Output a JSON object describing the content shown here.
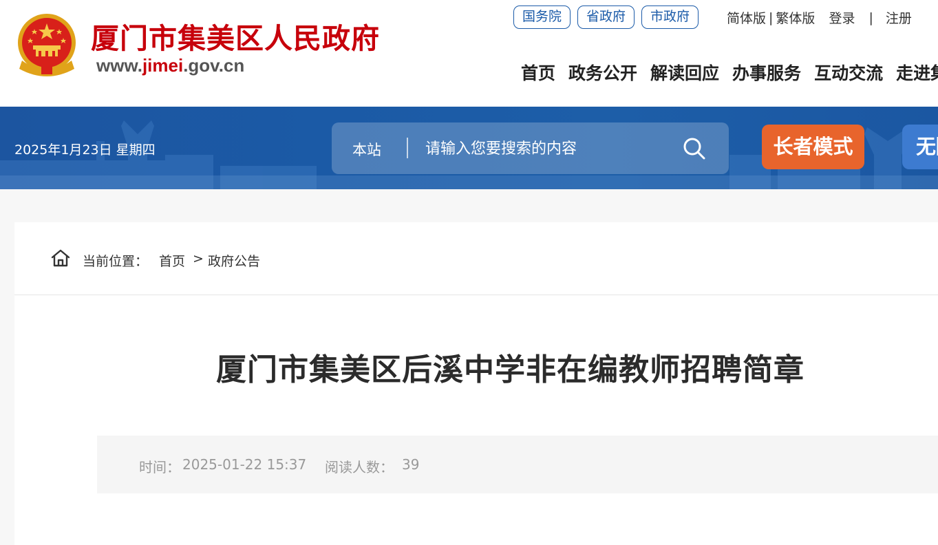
{
  "header": {
    "site_name": "厦门市集美区人民政府",
    "site_url_prefix": "www.",
    "site_url_accent": "jimei",
    "site_url_suffix": ".gov.cn",
    "gov_links": [
      "国务院",
      "省政府",
      "市政府"
    ],
    "lang_simplified": "简体版",
    "lang_separator": "|",
    "lang_traditional": "繁体版",
    "login": "登录",
    "util_separator": "|",
    "register": "注册",
    "nav": [
      "首页",
      "政务公开",
      "解读回应",
      "办事服务",
      "互动交流",
      "走进集美"
    ]
  },
  "banner": {
    "date": "2025年1月23日 星期四",
    "search_scope": "本站",
    "search_placeholder": "请输入您要搜索的内容",
    "elder_mode": "长者模式",
    "accessibility": "无障碍"
  },
  "breadcrumb": {
    "label": "当前位置：",
    "home": "首页",
    "separator": ">",
    "current": "政府公告"
  },
  "article": {
    "title": "厦门市集美区后溪中学非在编教师招聘简章",
    "time_label": "时间：",
    "time": "2025-01-22 15:37",
    "read_label": "阅读人数：",
    "read_count": "39"
  },
  "colors": {
    "brand_red": "#c7000b",
    "banner_blue": "#1b5aa6",
    "elder_orange": "#e8642c",
    "access_blue": "#3d7bd0"
  },
  "icons": [
    "national-emblem-icon",
    "search-icon",
    "home-icon"
  ]
}
